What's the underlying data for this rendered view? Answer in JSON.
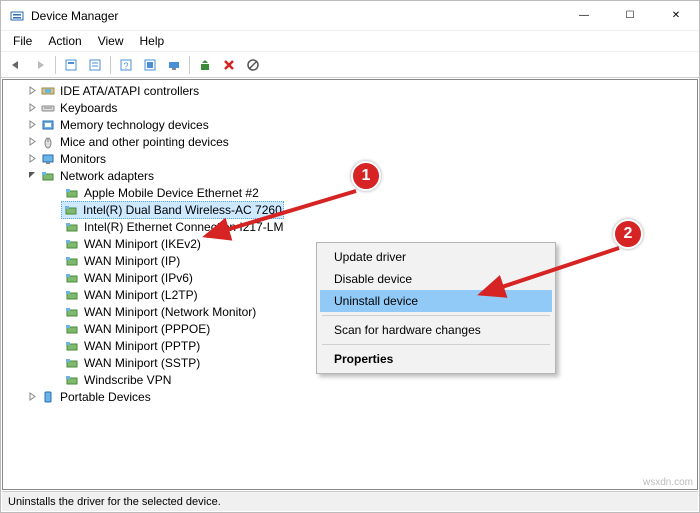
{
  "window": {
    "title": "Device Manager",
    "min": "—",
    "max": "☐",
    "close": "✕"
  },
  "menubar": [
    "File",
    "Action",
    "View",
    "Help"
  ],
  "statusbar": "Uninstalls the driver for the selected device.",
  "tree": {
    "categories": [
      {
        "label": "IDE ATA/ATAPI controllers",
        "icon": "ide"
      },
      {
        "label": "Keyboards",
        "icon": "kbd"
      },
      {
        "label": "Memory technology devices",
        "icon": "mem"
      },
      {
        "label": "Mice and other pointing devices",
        "icon": "mouse"
      },
      {
        "label": "Monitors",
        "icon": "mon"
      },
      {
        "label": "Network adapters",
        "icon": "net",
        "expanded": true
      },
      {
        "label": "Portable Devices",
        "icon": "port"
      }
    ],
    "net_children": [
      "Apple Mobile Device Ethernet #2",
      "Intel(R) Dual Band Wireless-AC 7260",
      "Intel(R) Ethernet Connection I217-LM",
      "WAN Miniport (IKEv2)",
      "WAN Miniport (IP)",
      "WAN Miniport (IPv6)",
      "WAN Miniport (L2TP)",
      "WAN Miniport (Network Monitor)",
      "WAN Miniport (PPPOE)",
      "WAN Miniport (PPTP)",
      "WAN Miniport (SSTP)",
      "Windscribe VPN"
    ],
    "selected_child_index": 1
  },
  "context_menu": {
    "items": [
      {
        "label": "Update driver"
      },
      {
        "label": "Disable device"
      },
      {
        "label": "Uninstall device",
        "highlight": true
      },
      {
        "sep": true
      },
      {
        "label": "Scan for hardware changes"
      },
      {
        "sep": true
      },
      {
        "label": "Properties",
        "bold": true
      }
    ]
  },
  "badges": {
    "b1": "1",
    "b2": "2"
  },
  "watermark": "wsxdn.com"
}
